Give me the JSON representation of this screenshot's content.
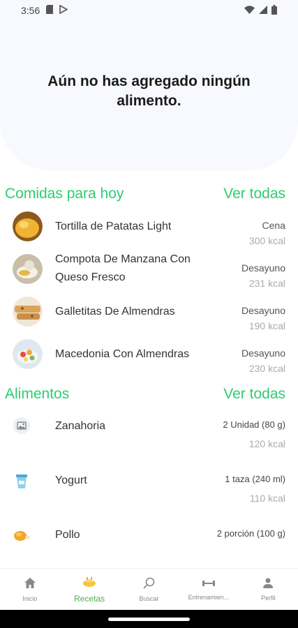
{
  "status_bar": {
    "time": "3:56"
  },
  "hero": {
    "message": "Aún no has agregado ningún alimento."
  },
  "meals_section": {
    "title": "Comidas para hoy",
    "see_all": "Ver todas"
  },
  "meals": [
    {
      "name": "Tortilla de Patatas Light",
      "type": "Cena",
      "kcal": "300 kcal"
    },
    {
      "name": "Compota De Manzana Con Queso Fresco",
      "type": "Desayuno",
      "kcal": "231 kcal"
    },
    {
      "name": "Galletitas De Almendras",
      "type": "Desayuno",
      "kcal": "190 kcal"
    },
    {
      "name": "Macedonia Con Almendras",
      "type": "Desayuno",
      "kcal": "230 kcal"
    }
  ],
  "foods_section": {
    "title": "Alimentos",
    "see_all": "Ver todas"
  },
  "foods": [
    {
      "name": "Zanahoria",
      "portion": "2 Unidad (80 g)",
      "kcal": "120 kcal",
      "icon": "image-placeholder-icon"
    },
    {
      "name": "Yogurt",
      "portion": "1 taza (240 ml)",
      "kcal": "110 kcal",
      "icon": "yogurt-cup-icon"
    },
    {
      "name": "Pollo",
      "portion": "2 porción (100 g)",
      "kcal": "",
      "icon": "chicken-icon"
    }
  ],
  "bottom_nav": [
    {
      "label": "Inicio",
      "icon": "home-icon"
    },
    {
      "label": "Recetas",
      "icon": "recipes-icon",
      "active": true
    },
    {
      "label": "Buscar",
      "icon": "search-icon"
    },
    {
      "label": "Entrenamien...",
      "icon": "dumbbell-icon"
    },
    {
      "label": "Perfil",
      "icon": "person-icon"
    }
  ],
  "colors": {
    "accent": "#2ecc71",
    "nav_active": "#4caf50",
    "hero_bg": "#f8f9fe"
  }
}
